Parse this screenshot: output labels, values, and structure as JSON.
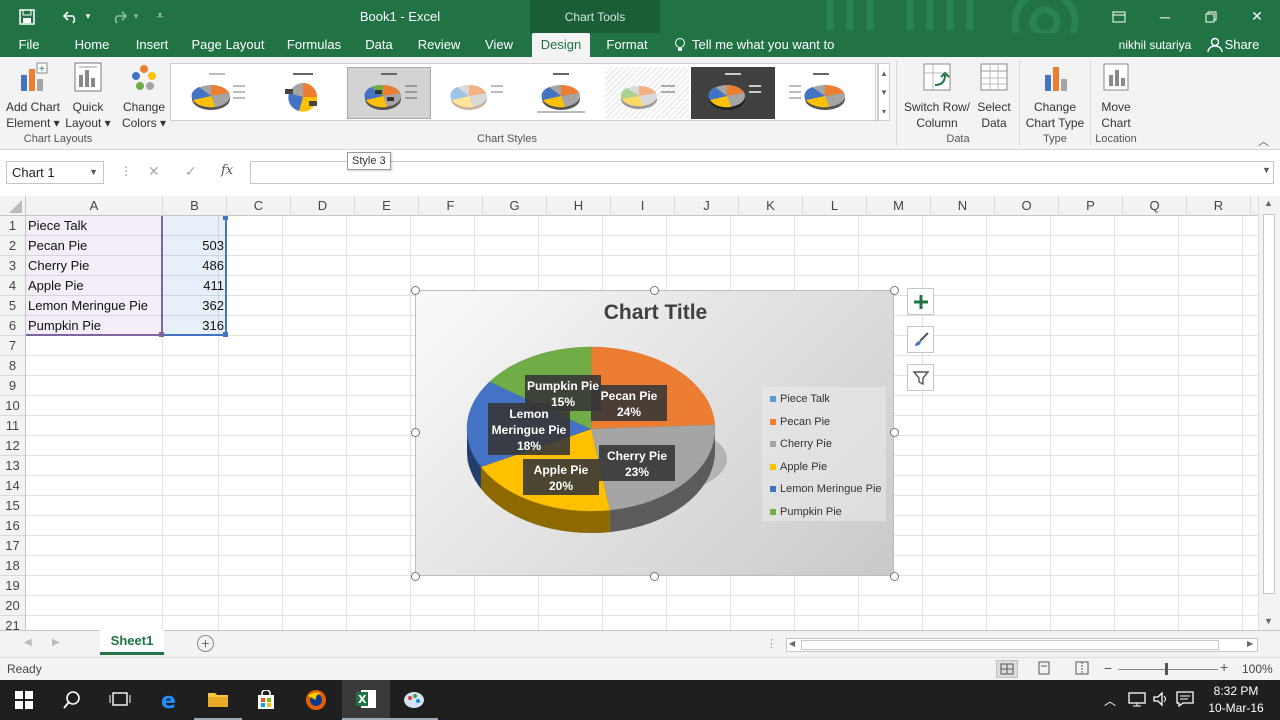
{
  "window": {
    "title": "Book1 - Excel",
    "contextual_group": "Chart Tools",
    "tell_me": "Tell me what you want to do...",
    "user": "nikhil sutariya",
    "share": "Share"
  },
  "tabs": [
    "File",
    "Home",
    "Insert",
    "Page Layout",
    "Formulas",
    "Data",
    "Review",
    "View",
    "Design",
    "Format"
  ],
  "active_tab": "Design",
  "ribbon": {
    "add_chart_element": [
      "Add Chart",
      "Element ▾"
    ],
    "quick_layout": [
      "Quick",
      "Layout ▾"
    ],
    "change_colors": [
      "Change",
      "Colors ▾"
    ],
    "chart_layouts_label": "Chart Layouts",
    "chart_styles_label": "Chart Styles",
    "switch_row_column": [
      "Switch Row/",
      "Column"
    ],
    "select_data": [
      "Select",
      "Data"
    ],
    "data_label": "Data",
    "change_chart_type": [
      "Change",
      "Chart Type"
    ],
    "type_label": "Type",
    "move_chart": [
      "Move",
      "Chart"
    ],
    "location_label": "Location",
    "tooltip": "Style 3"
  },
  "formula_bar": {
    "name_box": "Chart 1",
    "fx": "fx",
    "content": ""
  },
  "columns": [
    "A",
    "B",
    "C",
    "D",
    "E",
    "F",
    "G",
    "H",
    "I",
    "J",
    "K",
    "L",
    "M",
    "N",
    "O",
    "P",
    "Q",
    "R"
  ],
  "rows": [
    "1",
    "2",
    "3",
    "4",
    "5",
    "6",
    "7",
    "8",
    "9",
    "10",
    "11",
    "12",
    "13",
    "14",
    "15",
    "16",
    "17",
    "18",
    "19",
    "20",
    "21"
  ],
  "sheet": {
    "A1": "Piece Talk",
    "A2": "Pecan Pie",
    "B2": "503",
    "A3": "Cherry Pie",
    "B3": "486",
    "A4": "Apple Pie",
    "B4": "411",
    "A5": "Lemon Meringue Pie",
    "B5": "362",
    "A6": "Pumpkin Pie",
    "B6": "316"
  },
  "chart_data": {
    "type": "pie",
    "title": "Chart Title",
    "categories": [
      "Pecan Pie",
      "Cherry Pie",
      "Apple Pie",
      "Lemon Meringue Pie",
      "Pumpkin Pie"
    ],
    "values": [
      503,
      486,
      411,
      362,
      316
    ],
    "data_labels": [
      {
        "name": "Pecan Pie",
        "pct": "24%"
      },
      {
        "name": "Cherry Pie",
        "pct": "23%"
      },
      {
        "name": "Apple Pie",
        "pct": "20%"
      },
      {
        "name": "Lemon Meringue Pie",
        "pct": "18%"
      },
      {
        "name": "Pumpkin Pie",
        "pct": "15%"
      }
    ],
    "legend": [
      "Piece Talk",
      "Pecan Pie",
      "Cherry Pie",
      "Apple Pie",
      "Lemon Meringue Pie",
      "Pumpkin Pie"
    ],
    "legend_colors": [
      "#5b9bd5",
      "#ed7d31",
      "#a5a5a5",
      "#ffc000",
      "#4472c4",
      "#70ad47"
    ],
    "slice_colors": [
      "#ed7d31",
      "#a5a5a5",
      "#ffc000",
      "#4472c4",
      "#70ad47"
    ],
    "legend_position": "right"
  },
  "sheet_tab": "Sheet1",
  "status": {
    "ready": "Ready",
    "zoom": "100%"
  },
  "clock": {
    "time": "8:32 PM",
    "date": "10-Mar-16"
  }
}
